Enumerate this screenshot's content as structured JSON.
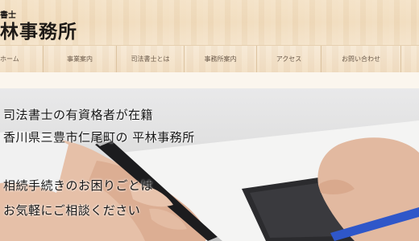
{
  "header": {
    "logo_small": "書士",
    "logo_big": "林事務所"
  },
  "nav": {
    "items": [
      {
        "label": "ホーム"
      },
      {
        "label": "事業案内"
      },
      {
        "label": "司法書士とは"
      },
      {
        "label": "事務所案内"
      },
      {
        "label": "アクセス"
      },
      {
        "label": "お問い合わせ"
      },
      {
        "label": ""
      }
    ]
  },
  "hero": {
    "line1": "司法書士の有資格者が在籍",
    "line2": "香川県三豊市仁尾町の 平林事務所",
    "line3": "相続手続きのお困りごとは",
    "line4": "お気軽にご相談ください"
  },
  "colors": {
    "wood": "#f2dfc4",
    "nav_text": "#6b5a4a",
    "hero_text": "#161616",
    "pen_blue": "#2f57c9"
  }
}
